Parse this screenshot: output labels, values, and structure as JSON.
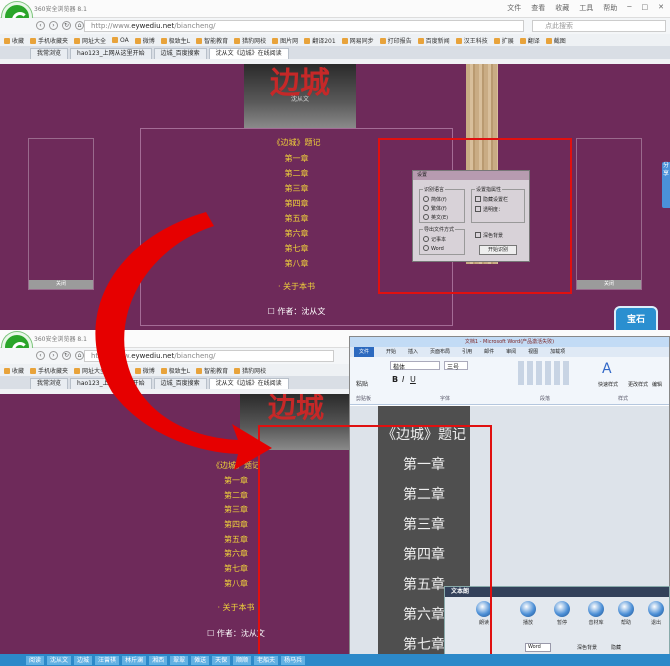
{
  "browser": {
    "app_name": "360安全浏览器 8.1",
    "url_prefix": "http://www.",
    "url_domain": "eywediu.net",
    "url_path": "/biancheng/",
    "search_placeholder": "点此搜索",
    "window_menu": [
      "文件",
      "查看",
      "收藏",
      "工具",
      "帮助"
    ],
    "favorites": [
      "收藏",
      "手机收藏夹",
      "网址大全",
      "OA",
      "微博",
      "极致生L",
      "智能教育",
      "猎豹网校",
      "图片网",
      "翻译201",
      "网易同步",
      "打印报告",
      "百度新闻",
      "汉王科技"
    ],
    "favorites_right": [
      "扩展",
      "翻译",
      "截图"
    ],
    "tabs": [
      "我常浏览",
      "hao123_上网从这里开始",
      "边城_百度搜索",
      "沈从文《边城》在线阅读"
    ],
    "tabs_lower": [
      "我常浏览",
      "hao123_上网从这里开始",
      "边城_百度搜索",
      "沈从文《边城》在线阅读"
    ]
  },
  "book": {
    "cover_title": "边城",
    "cover_subtitle": "沈从文",
    "toc_title": "《边城》题记",
    "chapters": [
      "第一章",
      "第二章",
      "第三章",
      "第四章",
      "第五章",
      "第六章",
      "第七章",
      "第八章"
    ],
    "about": "· 关于本书",
    "author": "☐ 作者：沈从文",
    "close_label": "关闭"
  },
  "settings_dialog": {
    "title": "设置",
    "group_language": "识别语言",
    "lang_options": [
      "简体(f)",
      "繁体(f)",
      "英文(E)"
    ],
    "group_attr": "设置指属性",
    "attr_options": [
      "隐藏设置栏",
      "透明度："
    ],
    "group_export": "导出文件方式",
    "export_options": [
      "记事本",
      "Word"
    ],
    "bg_option": "深色背景",
    "start_button": "开始识别"
  },
  "word": {
    "title": "文档1 - Microsoft Word(产品激活失败)",
    "tabs": [
      "文件",
      "开始",
      "插入",
      "页面布局",
      "引用",
      "邮件",
      "审阅",
      "视图",
      "加载项"
    ],
    "font_name": "楷体",
    "font_size": "三号",
    "paste_label": "粘贴",
    "style_labels": [
      "快速样式",
      "更改样式"
    ],
    "edit_label": "编辑",
    "group_labels": [
      "剪贴板",
      "字体",
      "段落",
      "样式"
    ],
    "doc_lines": [
      "《边城》题记",
      "第一章",
      "第二章",
      "第三章",
      "第四章",
      "第五章",
      "第六章",
      "第七章"
    ]
  },
  "tts": {
    "title": "文本朗",
    "buttons": [
      "朗读",
      "播放",
      "暂停",
      "音材库",
      "帮助",
      "退出"
    ],
    "voice": "Word",
    "checks": [
      "深色背景",
      "隐藏"
    ]
  },
  "bottom_bar": [
    "阅读",
    "沈从文",
    "边城",
    "汪曾祺",
    "林斤澜",
    "湘西",
    "翠翠",
    "傩送",
    "天保",
    "顺顺",
    "老船夫",
    "杨马兵"
  ],
  "side_tab": "分享",
  "float_button": "宝石"
}
